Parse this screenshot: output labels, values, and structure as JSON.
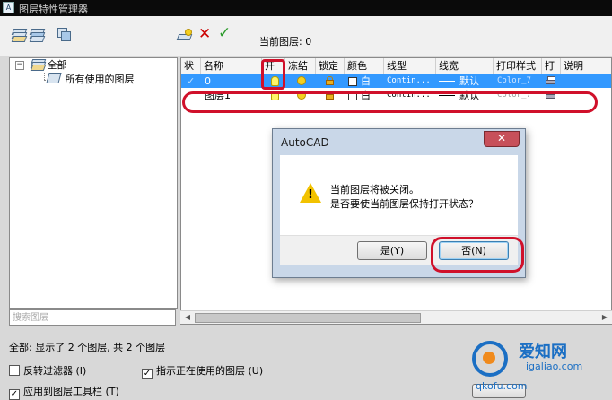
{
  "window": {
    "title": "图层特性管理器",
    "app_icon": "autocad-app-icon"
  },
  "toolbar": {
    "left_icons": [
      "new-property-filter-icon",
      "new-group-filter-icon",
      "layer-states-manager-icon"
    ],
    "right_icons": [
      "new-layer-icon",
      "delete-layer-icon",
      "set-current-icon"
    ],
    "delete_color": "#cc0000",
    "confirm_color": "#2a9a2a"
  },
  "current_layer": {
    "label": "当前图层:",
    "value": "0"
  },
  "tree": {
    "root": {
      "label": "全部",
      "toggle": "−"
    },
    "child": {
      "label": "所有使用的图层"
    }
  },
  "search": {
    "placeholder": "搜索图层"
  },
  "grid": {
    "columns": [
      "状",
      "名称",
      "开",
      "冻结",
      "锁定",
      "颜色",
      "线型",
      "线宽",
      "打印样式",
      "打",
      "说明"
    ],
    "rows": [
      {
        "status": "✓",
        "name": "0",
        "color": "白",
        "linetype": "Contin...",
        "lineweight": "默认",
        "plot_style": "Color_7",
        "selected": true
      },
      {
        "status": "",
        "name": "图层1",
        "color": "白",
        "linetype": "Contin...",
        "lineweight": "默认",
        "plot_style": "Color_7",
        "selected": false
      }
    ]
  },
  "status_text": "全部: 显示了 2 个图层, 共 2 个图层",
  "options": [
    {
      "label": "反转过滤器 (I)",
      "checked": false
    },
    {
      "label": "指示正在使用的图层 (U)",
      "checked": true
    },
    {
      "label": "应用到图层工具栏 (T)",
      "checked": true
    }
  ],
  "dialog": {
    "title": "AutoCAD",
    "close": "✕",
    "message_line1": "当前图层将被关闭。",
    "message_line2": "是否要使当前图层保持打开状态？",
    "yes_button": "是(Y)",
    "no_button": "否(N)",
    "icon": "warning-icon"
  },
  "annotation_color": "#d0102a",
  "watermark": {
    "line1": "爱知网",
    "line2": "igaliao.com",
    "line3": "qkofu.com"
  }
}
